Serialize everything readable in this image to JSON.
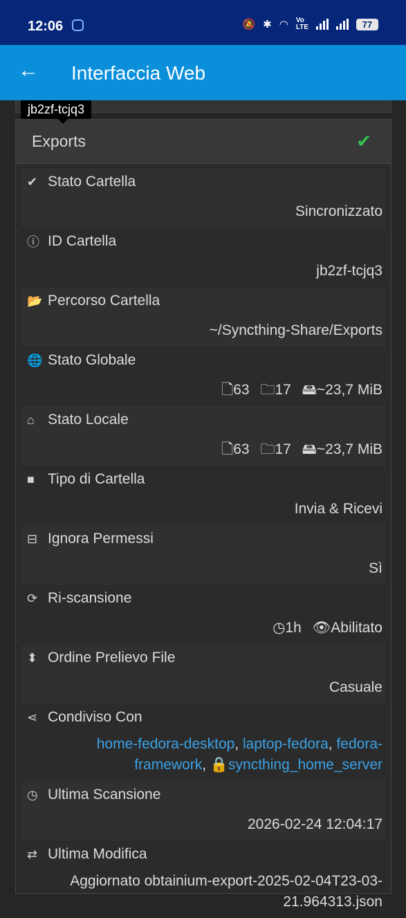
{
  "status_bar": {
    "time": "12:06",
    "battery": "77"
  },
  "app_bar": {
    "title": "Interfaccia Web"
  },
  "tooltip": "jb2zf-tcjq3",
  "folder": {
    "name": "Exports",
    "rows": {
      "stato_cartella": {
        "label": "Stato Cartella",
        "value": "Sincronizzato"
      },
      "id_cartella": {
        "label": "ID Cartella",
        "value": "jb2zf-tcjq3"
      },
      "percorso": {
        "label": "Percorso Cartella",
        "value": "~/Syncthing-Share/Exports"
      },
      "stato_globale": {
        "label": "Stato Globale",
        "files": "63",
        "dirs": "17",
        "size": "~23,7 MiB"
      },
      "stato_locale": {
        "label": "Stato Locale",
        "files": "63",
        "dirs": "17",
        "size": "~23,7 MiB"
      },
      "tipo": {
        "label": "Tipo di Cartella",
        "value": "Invia & Ricevi"
      },
      "ignora": {
        "label": "Ignora Permessi",
        "value": "Sì"
      },
      "riscansione": {
        "label": "Ri-scansione",
        "interval": "1h",
        "watch": "Abilitato"
      },
      "ordine": {
        "label": "Ordine Prelievo File",
        "value": "Casuale"
      },
      "condiviso": {
        "label": "Condiviso Con",
        "devices": [
          "home-fedora-desktop",
          "laptop-fedora",
          "fedora-framework",
          "syncthing_home_server"
        ]
      },
      "ultima_scansione": {
        "label": "Ultima Scansione",
        "value": "2026-02-24 12:04:17"
      },
      "ultima_modifica": {
        "label": "Ultima Modifica",
        "value": "Aggiornato obtainium-export-2025-02-04T23-03-21.964313.json"
      }
    }
  },
  "colors": {
    "app_bar": "#0b8fdb",
    "status_bar": "#06267a",
    "link": "#3ba1e6",
    "ok": "#33c24d"
  }
}
